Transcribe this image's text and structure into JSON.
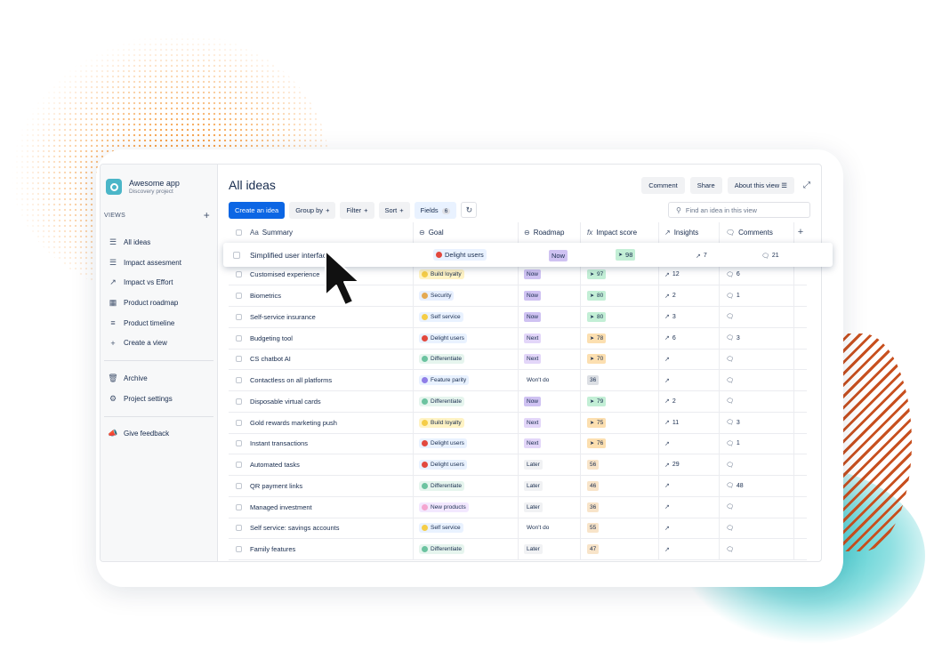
{
  "project": {
    "name": "Awesome app",
    "subtitle": "Discovery project"
  },
  "sidebar": {
    "views_label": "VIEWS",
    "views": [
      {
        "label": "All ideas",
        "icon": "list-icon"
      },
      {
        "label": "Impact assesment",
        "icon": "list-icon"
      },
      {
        "label": "Impact vs Effort",
        "icon": "chart-icon"
      },
      {
        "label": "Product roadmap",
        "icon": "board-icon"
      },
      {
        "label": "Product timeline",
        "icon": "timeline-icon"
      },
      {
        "label": "Create a view",
        "icon": "plus-icon"
      }
    ],
    "archive": "Archive",
    "settings": "Project settings",
    "feedback": "Give feedback"
  },
  "header": {
    "title": "All ideas",
    "comment": "Comment",
    "share": "Share",
    "about": "About this view"
  },
  "toolbar": {
    "create": "Create an idea",
    "group_by": "Group by",
    "filter": "Filter",
    "sort": "Sort",
    "fields": "Fields",
    "fields_count": "6",
    "search_placeholder": "Find an idea in this view"
  },
  "columns": {
    "summary": "Summary",
    "summary_prefix": "Aa",
    "goal": "Goal",
    "roadmap": "Roadmap",
    "impact": "Impact score",
    "impact_prefix": "fx",
    "insights": "Insights",
    "comments": "Comments"
  },
  "dragged_row": {
    "summary": "Simplified user interface",
    "goal": "Delight users",
    "roadmap": "Now",
    "impact": "98",
    "insights": "7",
    "comments": "21"
  },
  "rows": [
    {
      "summary": "Customised experience",
      "goal": "Build loyalty",
      "roadmap": "Now",
      "impact": "97",
      "insights": "12",
      "comments": "6"
    },
    {
      "summary": "Biometrics",
      "goal": "Security",
      "roadmap": "Now",
      "impact": "80",
      "insights": "2",
      "comments": "1"
    },
    {
      "summary": "Self-service insurance",
      "goal": "Self service",
      "roadmap": "Now",
      "impact": "80",
      "insights": "3",
      "comments": ""
    },
    {
      "summary": "Budgeting tool",
      "goal": "Delight users",
      "roadmap": "Next",
      "impact": "78",
      "insights": "6",
      "comments": "3"
    },
    {
      "summary": "CS chatbot AI",
      "goal": "Differentiate",
      "roadmap": "Next",
      "impact": "70",
      "insights": "",
      "comments": ""
    },
    {
      "summary": "Contactless on all platforms",
      "goal": "Feature parity",
      "roadmap": "Won't do",
      "impact": "36",
      "insights": "",
      "comments": ""
    },
    {
      "summary": "Disposable virtual cards",
      "goal": "Differentiate",
      "roadmap": "Now",
      "impact": "79",
      "insights": "2",
      "comments": ""
    },
    {
      "summary": "Gold rewards marketing push",
      "goal": "Build loyalty",
      "roadmap": "Next",
      "impact": "75",
      "insights": "11",
      "comments": "3"
    },
    {
      "summary": "Instant transactions",
      "goal": "Delight users",
      "roadmap": "Next",
      "impact": "76",
      "insights": "",
      "comments": "1"
    },
    {
      "summary": "Automated tasks",
      "goal": "Delight users",
      "roadmap": "Later",
      "impact": "56",
      "insights": "29",
      "comments": ""
    },
    {
      "summary": "QR payment links",
      "goal": "Differentiate",
      "roadmap": "Later",
      "impact": "46",
      "insights": "",
      "comments": "48"
    },
    {
      "summary": "Managed investment",
      "goal": "New products",
      "roadmap": "Later",
      "impact": "36",
      "insights": "",
      "comments": ""
    },
    {
      "summary": "Self service: savings accounts",
      "goal": "Self service",
      "roadmap": "Won't do",
      "impact": "55",
      "insights": "",
      "comments": ""
    },
    {
      "summary": "Family features",
      "goal": "Differentiate",
      "roadmap": "Later",
      "impact": "47",
      "insights": "",
      "comments": ""
    }
  ],
  "colors": {
    "primary": "#0c66e4",
    "goal_colors": {
      "Build loyalty": "#fff3c4",
      "Security": "#e8f0ff",
      "Self service": "#e9f2ff",
      "Delight users": "#e9f2ff",
      "Differentiate": "#e6f5ee",
      "Feature parity": "#e9f2ff",
      "New products": "#f3e8ff"
    },
    "goal_dots": {
      "Build loyalty": "#f5cd47",
      "Security": "#e4a951",
      "Self service": "#f5cd47",
      "Delight users": "#e2483d",
      "Differentiate": "#6cc3a0",
      "Feature parity": "#8f7ee7",
      "New products": "#f4a6d0"
    }
  }
}
